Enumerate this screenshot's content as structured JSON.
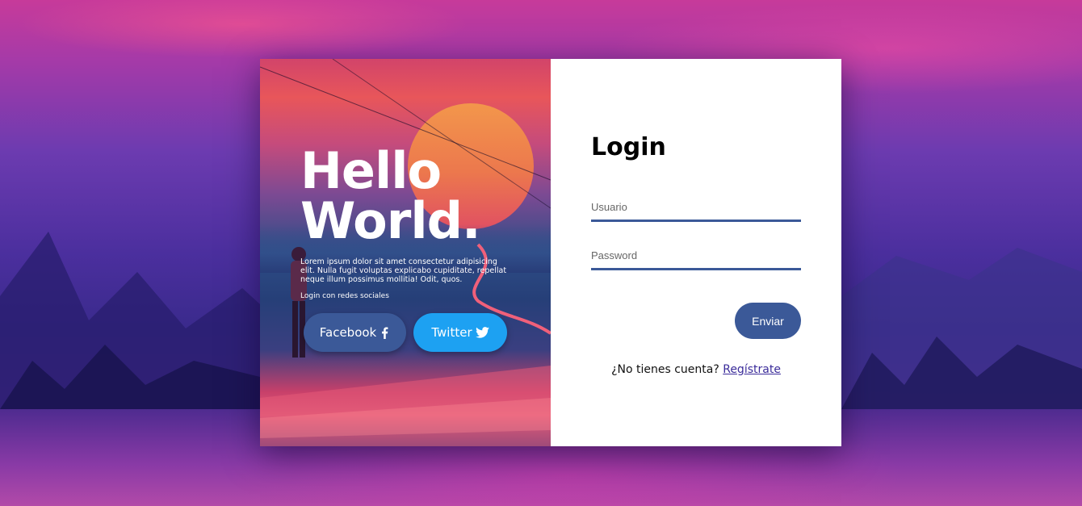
{
  "hero": {
    "line1": "Hello",
    "line2": "World.",
    "description": "Lorem ipsum dolor sit amet consectetur adipisicing elit. Nulla fugit voluptas explicabo cupiditate, repellat neque illum possimus mollitia! Odit, quos.",
    "social_label": "Login con redes sociales"
  },
  "social": {
    "facebook_label": "Facebook",
    "twitter_label": "Twitter",
    "facebook_color": "#3b5998",
    "twitter_color": "#1da1f2",
    "facebook_icon": "facebook-icon",
    "twitter_icon": "twitter-icon"
  },
  "login": {
    "title": "Login",
    "user_placeholder": "Usuario",
    "user_value": "",
    "pass_placeholder": "Password",
    "pass_value": "",
    "submit_label": "Enviar",
    "register_prompt": "¿No tienes cuenta?",
    "register_link": "Regístrate",
    "accent_color": "#3b5998"
  }
}
